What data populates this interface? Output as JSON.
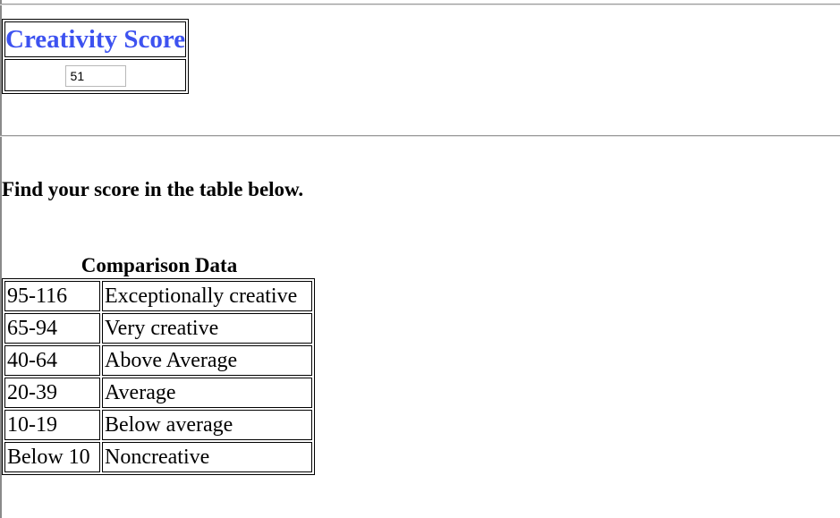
{
  "score_panel": {
    "title": "Creativity Score",
    "value": "51"
  },
  "instruction": "Find your score in the table below.",
  "comparison": {
    "caption": "Comparison Data",
    "rows": [
      {
        "range": "95-116",
        "label": "Exceptionally creative"
      },
      {
        "range": "65-94",
        "label": "Very creative"
      },
      {
        "range": "40-64",
        "label": "Above Average"
      },
      {
        "range": "20-39",
        "label": "Average"
      },
      {
        "range": "10-19",
        "label": "Below average"
      },
      {
        "range": "Below 10",
        "label": "Noncreative"
      }
    ]
  },
  "colors": {
    "title_blue": "#3d52f0",
    "rule_gray": "#9a9a9a"
  }
}
